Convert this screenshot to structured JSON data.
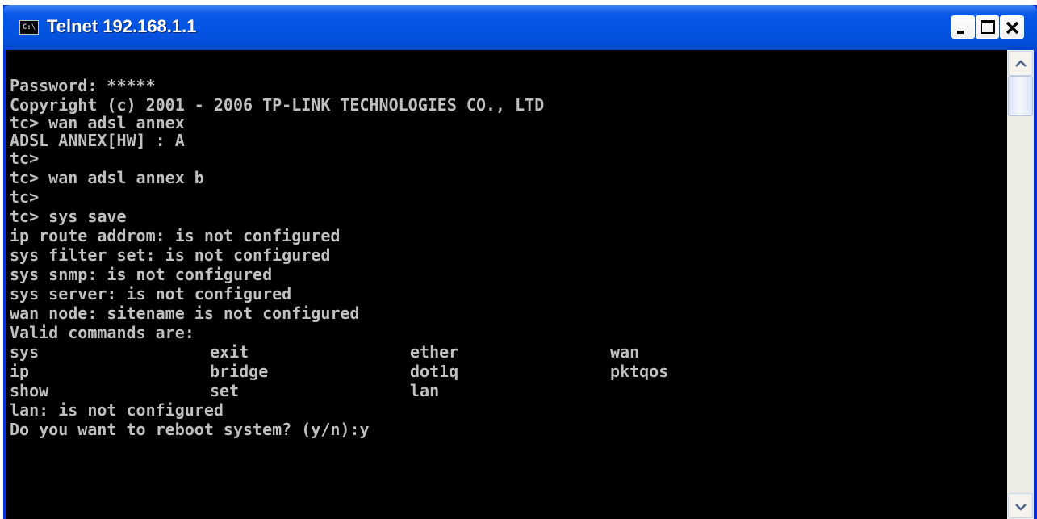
{
  "window": {
    "title": "Telnet 192.168.1.1",
    "icon_label": "C:\\"
  },
  "terminal": {
    "lines": [
      "Password: *****",
      "Copyright (c) 2001 - 2006 TP-LINK TECHNOLOGIES CO., LTD",
      "tc> wan adsl annex",
      "ADSL ANNEX[HW] : A",
      "tc>",
      "tc> wan adsl annex b",
      "tc>",
      "tc> sys save",
      "ip route addrom: is not configured",
      "sys filter set: is not configured",
      "sys snmp: is not configured",
      "sys server: is not configured",
      "wan node: sitename is not configured",
      "Valid commands are:"
    ],
    "command_table": [
      [
        "sys",
        "exit",
        "ether",
        "wan"
      ],
      [
        "ip",
        "bridge",
        "dot1q",
        "pktqos"
      ],
      [
        "show",
        "set",
        "lan",
        ""
      ]
    ],
    "tail_lines": [
      "lan: is not configured",
      "Do you want to reboot system? (y/n):y"
    ]
  },
  "colors": {
    "terminal_bg": "#000000",
    "terminal_fg": "#c0c0c0",
    "titlebar": "#0454e3",
    "close_button": "#d9442e"
  },
  "icons": {
    "app": "console-icon",
    "minimize": "minimize-icon",
    "maximize": "maximize-icon",
    "close": "close-icon",
    "scroll_up": "arrow-up-icon",
    "scroll_down": "arrow-down-icon"
  }
}
